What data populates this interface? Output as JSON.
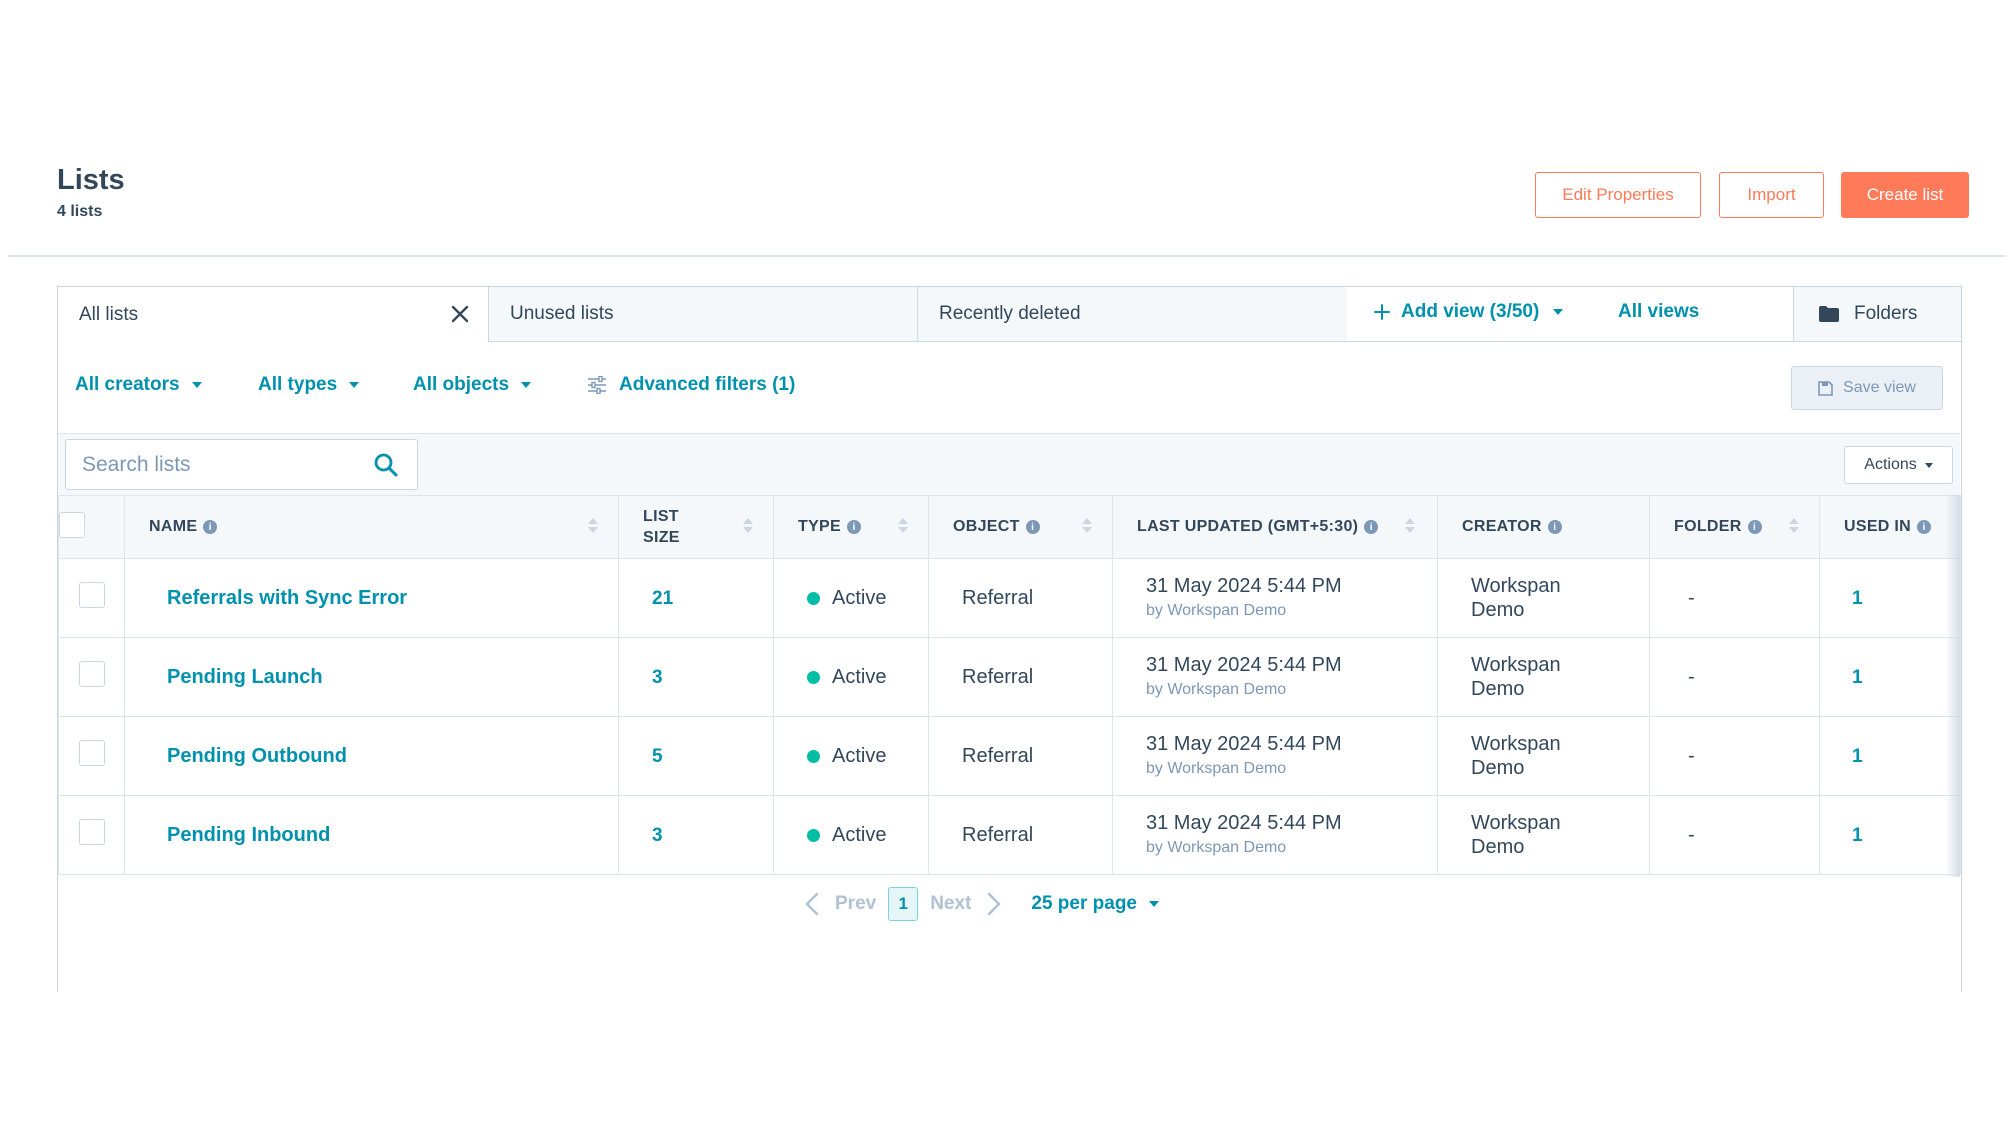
{
  "header": {
    "title": "Lists",
    "subtitle": "4 lists",
    "edit_properties": "Edit Properties",
    "import": "Import",
    "create_list": "Create list"
  },
  "tabs": {
    "all_lists": "All lists",
    "unused_lists": "Unused lists",
    "recently_deleted": "Recently deleted",
    "add_view": "Add view (3/50)",
    "all_views": "All views",
    "folders": "Folders"
  },
  "filters": {
    "creators": "All creators",
    "types": "All types",
    "objects": "All objects",
    "advanced": "Advanced filters (1)",
    "save_view": "Save view"
  },
  "search": {
    "placeholder": "Search lists"
  },
  "actions_label": "Actions",
  "table": {
    "columns": {
      "name": "NAME",
      "size_l1": "LIST",
      "size_l2": "SIZE",
      "type": "TYPE",
      "object": "OBJECT",
      "updated": "LAST UPDATED (GMT+5:30)",
      "creator": "CREATOR",
      "folder": "FOLDER",
      "used_in": "USED IN"
    },
    "rows": [
      {
        "name": "Referrals with Sync Error",
        "size": "21",
        "type": "Active",
        "object": "Referral",
        "updated": "31 May 2024 5:44 PM",
        "updated_by": "by Workspan Demo",
        "creator_l1": "Workspan",
        "creator_l2": "Demo",
        "folder": "-",
        "used_in": "1"
      },
      {
        "name": "Pending Launch",
        "size": "3",
        "type": "Active",
        "object": "Referral",
        "updated": "31 May 2024 5:44 PM",
        "updated_by": "by Workspan Demo",
        "creator_l1": "Workspan",
        "creator_l2": "Demo",
        "folder": "-",
        "used_in": "1"
      },
      {
        "name": "Pending Outbound",
        "size": "5",
        "type": "Active",
        "object": "Referral",
        "updated": "31 May 2024 5:44 PM",
        "updated_by": "by Workspan Demo",
        "creator_l1": "Workspan",
        "creator_l2": "Demo",
        "folder": "-",
        "used_in": "1"
      },
      {
        "name": "Pending Inbound",
        "size": "3",
        "type": "Active",
        "object": "Referral",
        "updated": "31 May 2024 5:44 PM",
        "updated_by": "by Workspan Demo",
        "creator_l1": "Workspan",
        "creator_l2": "Demo",
        "folder": "-",
        "used_in": "1"
      }
    ]
  },
  "pagination": {
    "prev": "Prev",
    "current": "1",
    "next": "Next",
    "per_page": "25 per page"
  },
  "colors": {
    "accent_orange": "#ff7a59",
    "link_teal": "#0091ae",
    "status_active": "#00bda5",
    "text_dark": "#33475b",
    "border": "#cbd6e2"
  },
  "icons": [
    "close-icon",
    "plus-icon",
    "folder-icon",
    "sliders-icon",
    "save-icon",
    "search-icon",
    "info-icon",
    "sort-icon",
    "chevron-left-icon",
    "chevron-right-icon",
    "caret-down-icon"
  ]
}
